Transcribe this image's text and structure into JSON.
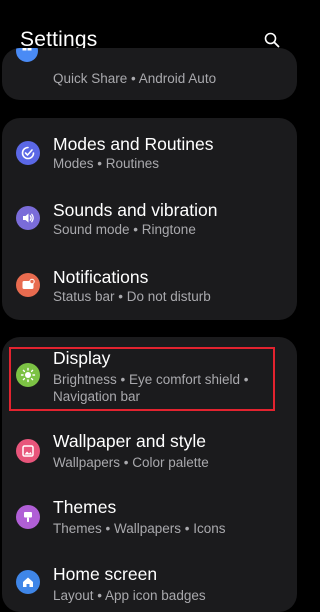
{
  "header": {
    "title": "Settings",
    "search_icon": "search-icon"
  },
  "top_item": {
    "subtitle": "Quick Share  •  Android Auto",
    "icon_color": "#4a8bf5"
  },
  "items": [
    {
      "label": "Modes and Routines",
      "subtitle": "Modes  •  Routines",
      "icon": "modes-icon",
      "icon_color": "#5b68e6"
    },
    {
      "label": "Sounds and vibration",
      "subtitle": "Sound mode  •  Ringtone",
      "icon": "volume-icon",
      "icon_color": "#7a6cd9"
    },
    {
      "label": "Notifications",
      "subtitle": "Status bar  •  Do not disturb",
      "icon": "notification-icon",
      "icon_color": "#e86b4f"
    },
    {
      "label": "Display",
      "subtitle_line1": "Brightness  •  Eye comfort shield  •",
      "subtitle_line2": "Navigation bar",
      "icon": "brightness-icon",
      "icon_color": "#7cc244"
    },
    {
      "label": "Wallpaper and style",
      "subtitle": "Wallpapers  •  Color palette",
      "icon": "wallpaper-icon",
      "icon_color": "#e8557b"
    },
    {
      "label": "Themes",
      "subtitle": "Themes  •  Wallpapers  •  Icons",
      "icon": "themes-icon",
      "icon_color": "#b05fd6"
    },
    {
      "label": "Home screen",
      "subtitle": "Layout  •  App icon badges",
      "icon": "home-icon",
      "icon_color": "#3f86e8"
    }
  ],
  "highlight_color": "#e3232f"
}
